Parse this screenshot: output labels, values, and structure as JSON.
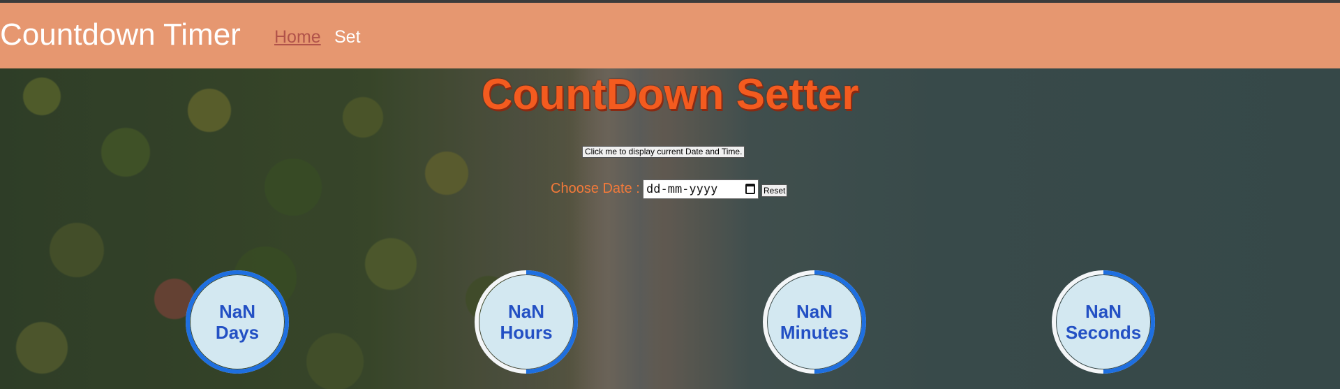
{
  "navbar": {
    "brand": "Countdown Timer",
    "links": [
      {
        "label": "Home",
        "active": true
      },
      {
        "label": "Set",
        "active": false
      }
    ],
    "background": "#e69770"
  },
  "page": {
    "title": "CountDown Setter",
    "now_button_label": "Click me to display current Date and Time.",
    "date_label": "Choose Date :",
    "date_placeholder": "dd-mm-yyyy",
    "reset_label": "Reset",
    "background_image": "aerial-forest-beach-photo",
    "title_color": "#f35b1f"
  },
  "dials": [
    {
      "value": "NaN",
      "unit": "Days",
      "progress": 1.0
    },
    {
      "value": "NaN",
      "unit": "Hours",
      "progress": 0.5
    },
    {
      "value": "NaN",
      "unit": "Minutes",
      "progress": 0.5
    },
    {
      "value": "NaN",
      "unit": "Seconds",
      "progress": 0.5
    }
  ],
  "dial_colors": {
    "ring": "#1e6fe0",
    "track": "#f4f6f8",
    "face": "#d3e8f1",
    "text": "#2350c4"
  }
}
